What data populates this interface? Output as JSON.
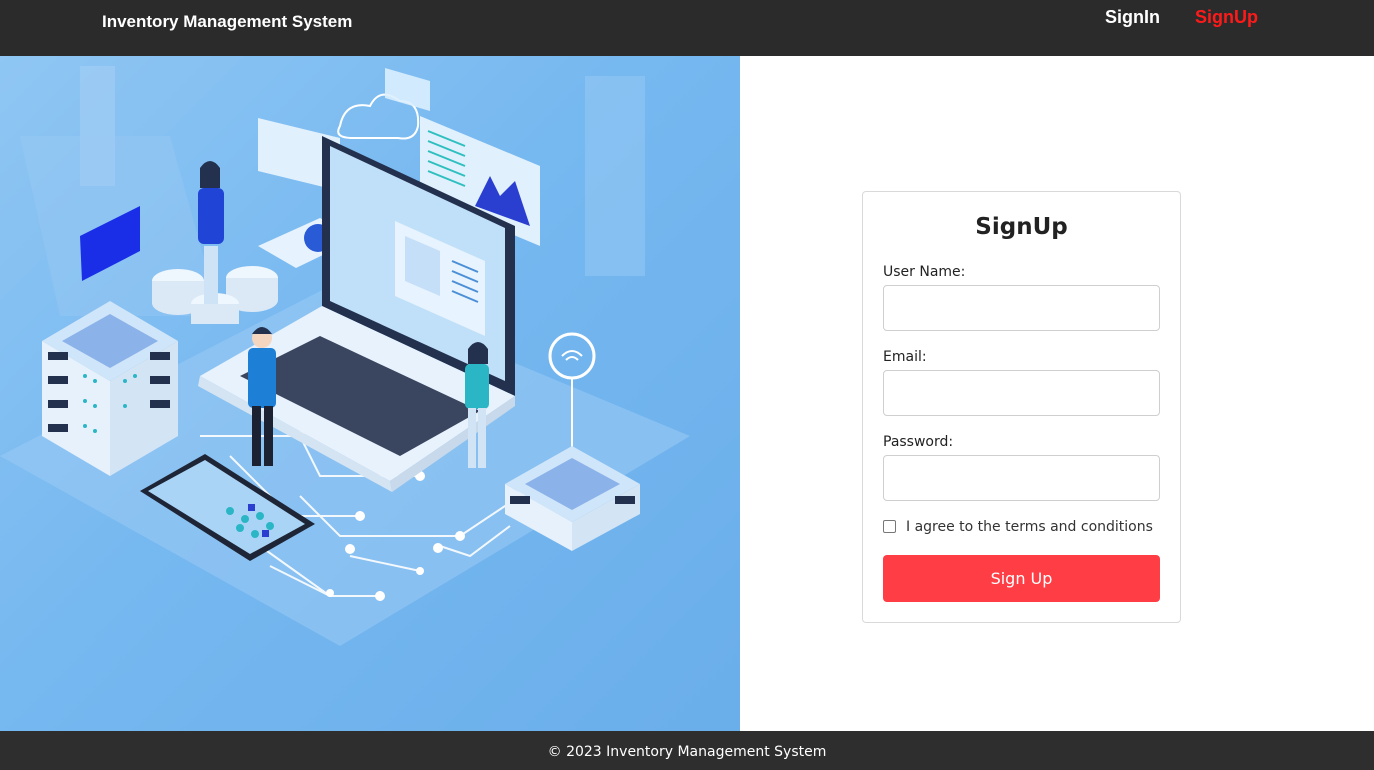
{
  "header": {
    "brand": "Inventory Management System",
    "nav": {
      "signin": "SignIn",
      "signup": "SignUp"
    }
  },
  "hero": {
    "illustration": "isometric-network-laptop-illustration"
  },
  "form": {
    "title": "SignUp",
    "username_label": "User Name:",
    "username_value": "",
    "email_label": "Email:",
    "email_value": "",
    "password_label": "Password:",
    "password_value": "",
    "terms_label": "I agree to the terms and conditions",
    "terms_checked": false,
    "submit_label": "Sign Up"
  },
  "footer": {
    "text": "© 2023 Inventory Management System"
  },
  "colors": {
    "topbar": "#2b2b2b",
    "accent_red": "#ff3d45",
    "nav_active": "#ff1a1a",
    "hero_blue": "#76b8f0"
  }
}
